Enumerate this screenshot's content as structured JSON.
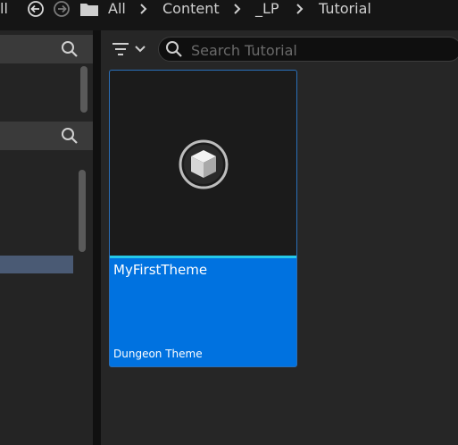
{
  "breadcrumb": {
    "clipped_glyph": "ll",
    "items": [
      "All",
      "Content",
      "_LP",
      "Tutorial"
    ]
  },
  "search": {
    "placeholder": "Search Tutorial",
    "value": ""
  },
  "asset": {
    "name": "MyFirstTheme",
    "type": "Dungeon Theme"
  },
  "colors": {
    "selection": "#0072e0",
    "thumbnail_bar": "#25c8e8",
    "selected_source_row": "#4a5a74"
  }
}
